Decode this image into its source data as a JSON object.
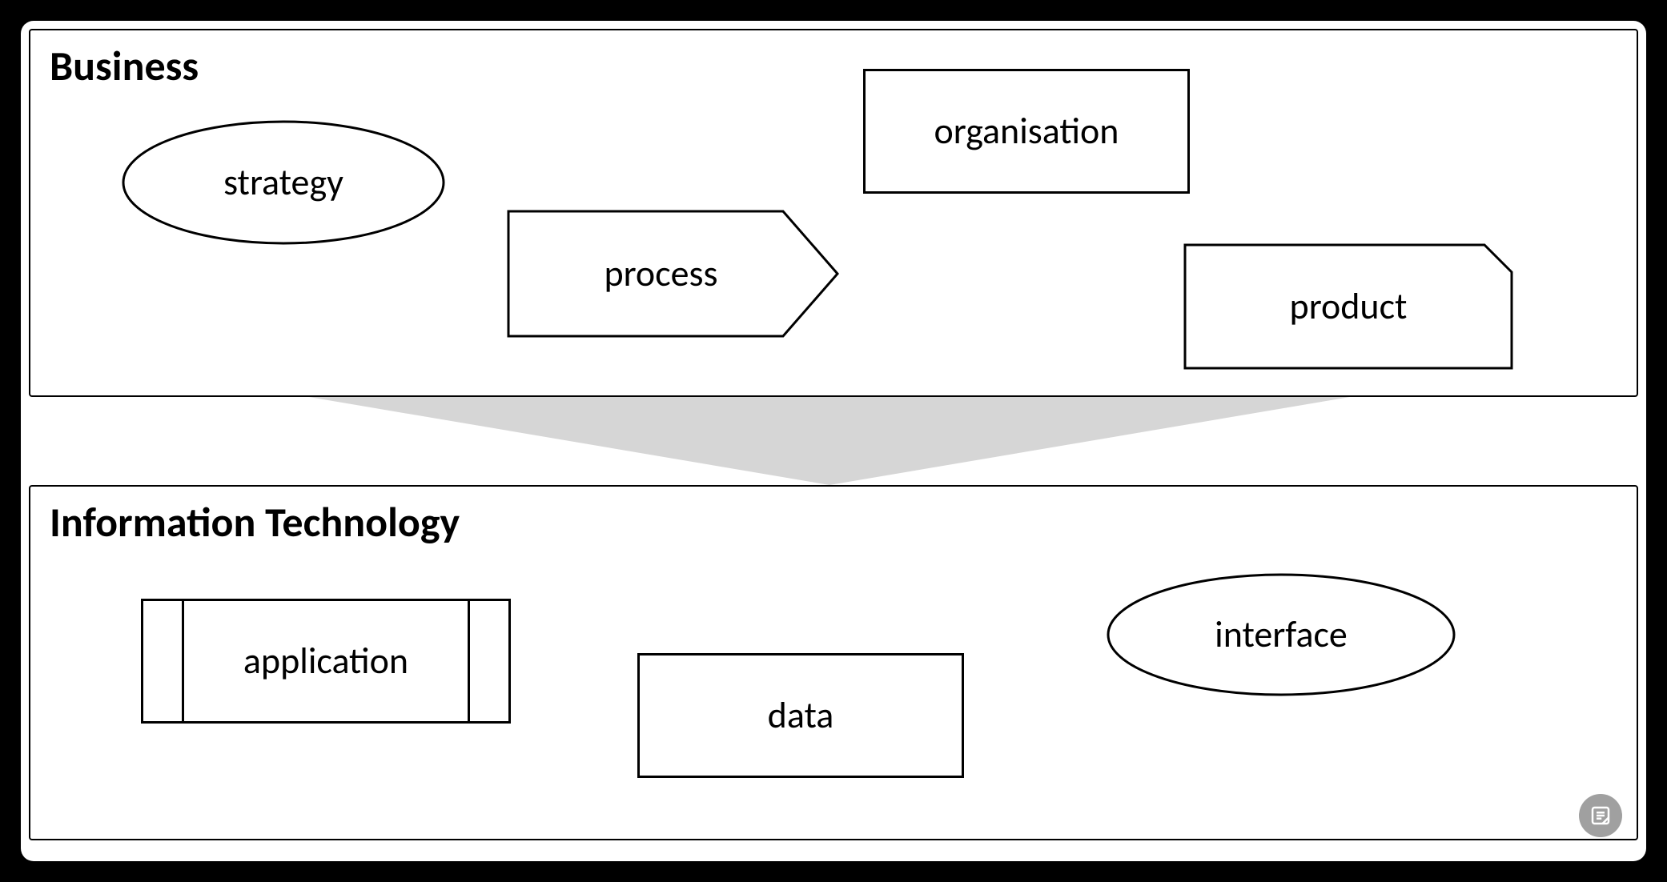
{
  "domains": {
    "business": {
      "title": "Business",
      "shapes": {
        "strategy": {
          "label": "strategy",
          "type": "ellipse"
        },
        "organisation": {
          "label": "organisation",
          "type": "rectangle"
        },
        "process": {
          "label": "process",
          "type": "arrow-box"
        },
        "product": {
          "label": "product",
          "type": "snipped-rect"
        }
      }
    },
    "it": {
      "title": "Information Technology",
      "shapes": {
        "application": {
          "label": "application",
          "type": "predefined-process"
        },
        "data": {
          "label": "data",
          "type": "rectangle"
        },
        "interface": {
          "label": "interface",
          "type": "ellipse"
        }
      }
    }
  },
  "connector": {
    "direction": "down",
    "color": "#d6d6d6"
  },
  "icons": {
    "notes": "notes-icon"
  }
}
